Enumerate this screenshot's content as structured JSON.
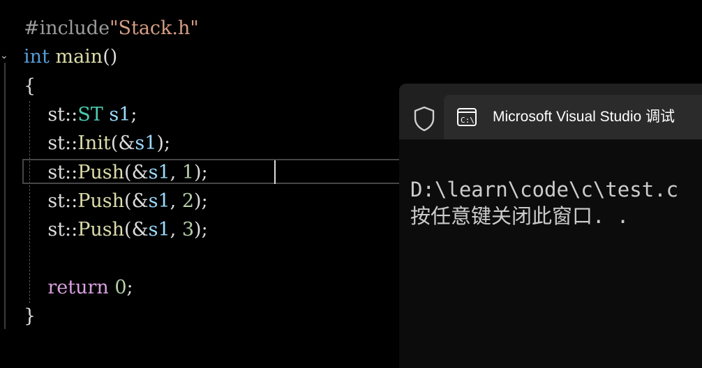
{
  "editor": {
    "fold_glyph": "⌄",
    "lines": [
      {
        "tokens": [
          {
            "cls": "c-pre",
            "text": "#include"
          },
          {
            "cls": "c-str",
            "text": "\"Stack.h\""
          }
        ]
      },
      {
        "tokens": [
          {
            "cls": "c-kw",
            "text": "int"
          },
          {
            "cls": "c-plain",
            "text": " "
          },
          {
            "cls": "c-fn",
            "text": "main"
          },
          {
            "cls": "c-plain",
            "text": "()"
          }
        ]
      },
      {
        "tokens": [
          {
            "cls": "c-plain",
            "text": "{"
          }
        ]
      },
      {
        "tokens": [
          {
            "cls": "c-plain",
            "text": "    st::"
          },
          {
            "cls": "c-type",
            "text": "ST"
          },
          {
            "cls": "c-plain",
            "text": " "
          },
          {
            "cls": "c-var",
            "text": "s1"
          },
          {
            "cls": "c-plain",
            "text": ";"
          }
        ]
      },
      {
        "tokens": [
          {
            "cls": "c-plain",
            "text": "    st::"
          },
          {
            "cls": "c-fn",
            "text": "Init"
          },
          {
            "cls": "c-plain",
            "text": "(&"
          },
          {
            "cls": "c-var",
            "text": "s1"
          },
          {
            "cls": "c-plain",
            "text": ");"
          }
        ]
      },
      {
        "tokens": [
          {
            "cls": "c-plain",
            "text": "    st::"
          },
          {
            "cls": "c-fn",
            "text": "Push"
          },
          {
            "cls": "c-plain",
            "text": "(&"
          },
          {
            "cls": "c-var",
            "text": "s1"
          },
          {
            "cls": "c-plain",
            "text": ", "
          },
          {
            "cls": "c-num",
            "text": "1"
          },
          {
            "cls": "c-plain",
            "text": ");"
          }
        ]
      },
      {
        "tokens": [
          {
            "cls": "c-plain",
            "text": "    st::"
          },
          {
            "cls": "c-fn",
            "text": "Push"
          },
          {
            "cls": "c-plain",
            "text": "(&"
          },
          {
            "cls": "c-var",
            "text": "s1"
          },
          {
            "cls": "c-plain",
            "text": ", "
          },
          {
            "cls": "c-num",
            "text": "2"
          },
          {
            "cls": "c-plain",
            "text": ");"
          }
        ]
      },
      {
        "tokens": [
          {
            "cls": "c-plain",
            "text": "    st::"
          },
          {
            "cls": "c-fn",
            "text": "Push"
          },
          {
            "cls": "c-plain",
            "text": "(&"
          },
          {
            "cls": "c-var",
            "text": "s1"
          },
          {
            "cls": "c-plain",
            "text": ", "
          },
          {
            "cls": "c-num",
            "text": "3"
          },
          {
            "cls": "c-plain",
            "text": ");"
          }
        ]
      },
      {
        "tokens": []
      },
      {
        "tokens": [
          {
            "cls": "c-plain",
            "text": "    "
          },
          {
            "cls": "c-ret",
            "text": "return"
          },
          {
            "cls": "c-plain",
            "text": " "
          },
          {
            "cls": "c-num",
            "text": "0"
          },
          {
            "cls": "c-plain",
            "text": ";"
          }
        ]
      },
      {
        "tokens": [
          {
            "cls": "c-plain",
            "text": "}"
          }
        ]
      }
    ]
  },
  "console": {
    "tab_title": "Microsoft Visual Studio 调试",
    "tab_icon": "console-app-icon",
    "shield_icon": "shield-icon",
    "output_lines": [
      "D:\\learn\\code\\c\\test.c",
      "按任意键关闭此窗口. ."
    ]
  }
}
